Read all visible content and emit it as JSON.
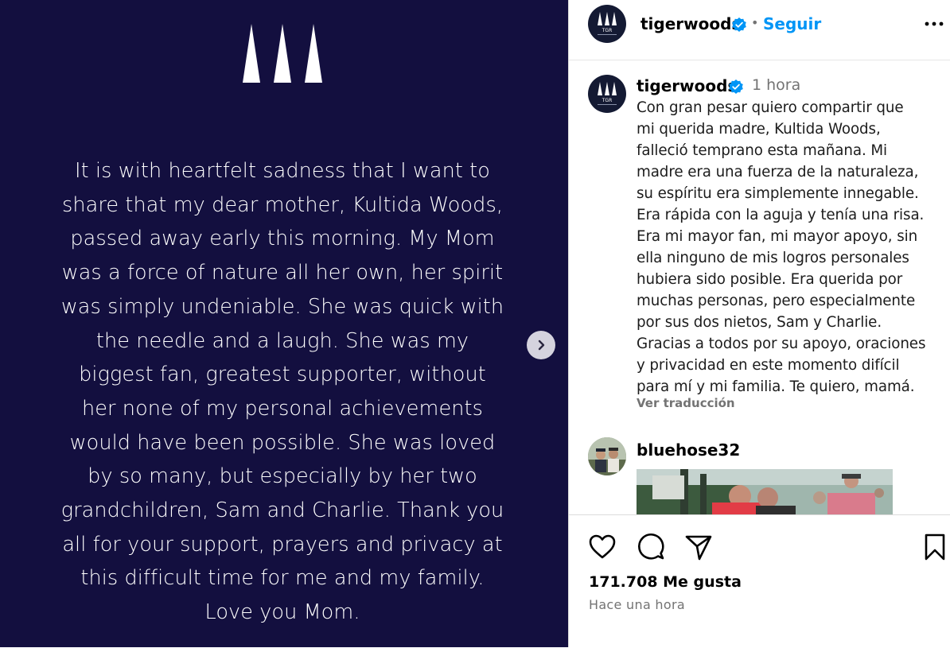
{
  "image": {
    "text": "It is with heartfelt sadness that I want to\nshare that my dear mother, Kultida Woods,\npassed away early this morning. My Mom\nwas a force of nature all her own, her spirit\nwas simply undeniable. She was quick with\nthe needle and a laugh. She was my\nbiggest fan, greatest supporter, without\nher none of my personal achievements\nwould have been possible. She was loved\nby so many, but especially by her two\ngrandchildren, Sam and Charlie. Thank you\nall for your support, prayers and privacy at\nthis difficult time for me and my family.\nLove you Mom.",
    "background_color": "#130f3f",
    "logo_icon": "tgr-three-spires-icon",
    "next_icon": "chevron-right-icon"
  },
  "header": {
    "username": "tigerwoods",
    "separator": "•",
    "follow_label": "Seguir",
    "avatar_label": "TGR",
    "more_icon": "more-horizontal-icon"
  },
  "caption": {
    "username": "tigerwoods",
    "time": "1 hora",
    "text": "Con gran pesar quiero compartir que\nmi querida madre, Kultida Woods,\nfalleció temprano esta mañana. Mi\nmadre era una fuerza de la naturaleza,\nsu espíritu era simplemente innegable.\nEra rápida con la aguja y tenía una risa.\nEra mi mayor fan, mi mayor apoyo, sin\nella ninguno de mis logros personales\nhubiera sido posible. Era querida por\nmuchas personas, pero especialmente\npor sus dos nietos, Sam y Charlie.\nGracias a todos por su apoyo, oraciones\ny privacidad en este momento difícil\npara mí y mi familia. Te quiero, mamá.",
    "translate_label": "Ver traducción"
  },
  "comment": {
    "username": "bluehose32"
  },
  "actions": {
    "likes": "171.708 Me gusta",
    "posted": "Hace una hora",
    "icons": [
      "heart-icon",
      "comment-icon",
      "share-icon",
      "bookmark-icon"
    ]
  },
  "colors": {
    "accent": "#0095f6",
    "verified": "#0095f6",
    "muted": "#737373"
  }
}
